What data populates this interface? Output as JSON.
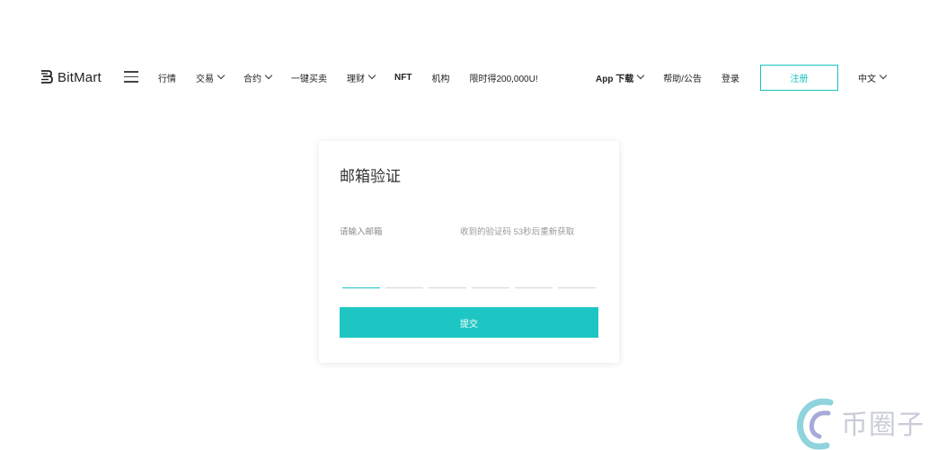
{
  "header": {
    "logo_text": "BitMart",
    "nav": [
      {
        "label": "行情",
        "has_dropdown": false
      },
      {
        "label": "交易",
        "has_dropdown": true
      },
      {
        "label": "合约",
        "has_dropdown": true
      },
      {
        "label": "一键买卖",
        "has_dropdown": false
      },
      {
        "label": "理财",
        "has_dropdown": true
      },
      {
        "label": "NFT",
        "has_dropdown": false
      },
      {
        "label": "机构",
        "has_dropdown": false
      },
      {
        "label": "限时得200,000U!",
        "has_dropdown": false
      }
    ],
    "app_download": "App 下载",
    "help": "帮助/公告",
    "login": "登录",
    "signup": "注册",
    "language": "中文"
  },
  "card": {
    "title": "邮箱验证",
    "email_label": "请输入邮箱",
    "code_label": "收到的验证码 53秒后重新获取",
    "code_length": 6,
    "submit": "提交"
  },
  "watermark": {
    "text": "币圈子"
  },
  "colors": {
    "accent": "#1ec6c3"
  }
}
